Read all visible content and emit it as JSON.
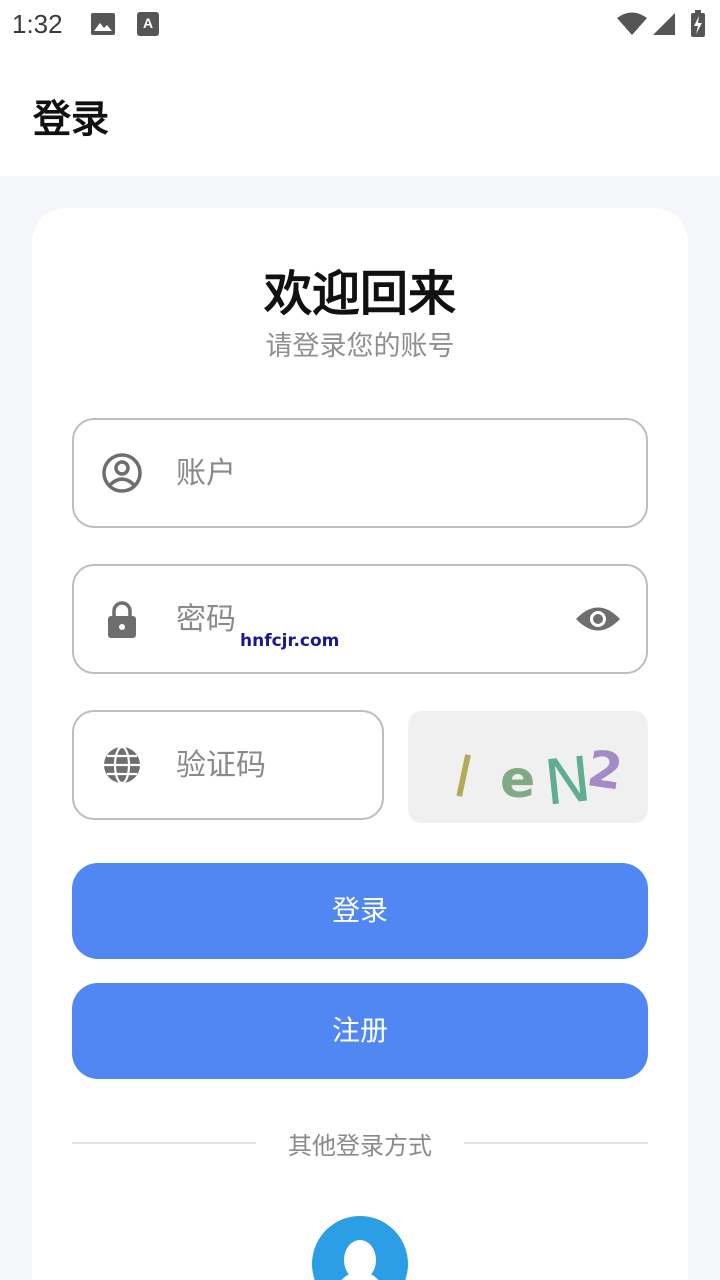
{
  "status_bar": {
    "time": "1:32",
    "left_icons": [
      "image-icon",
      "font-icon"
    ],
    "right_icons": [
      "wifi-icon",
      "signal-icon",
      "battery-charging-icon"
    ]
  },
  "app_bar": {
    "title": "登录"
  },
  "login": {
    "welcome": "欢迎回来",
    "subtitle": "请登录您的账号",
    "account_placeholder": "账户",
    "password_placeholder": "密码",
    "captcha_placeholder": "验证码",
    "captcha_text": "IeN2",
    "watermark": "hnfcjr.com",
    "login_label": "登录",
    "register_label": "注册",
    "other_login": "其他登录方式"
  },
  "colors": {
    "primary": "#5087f2",
    "qq": "#2b9ee6",
    "background": "#f4f6fa"
  }
}
